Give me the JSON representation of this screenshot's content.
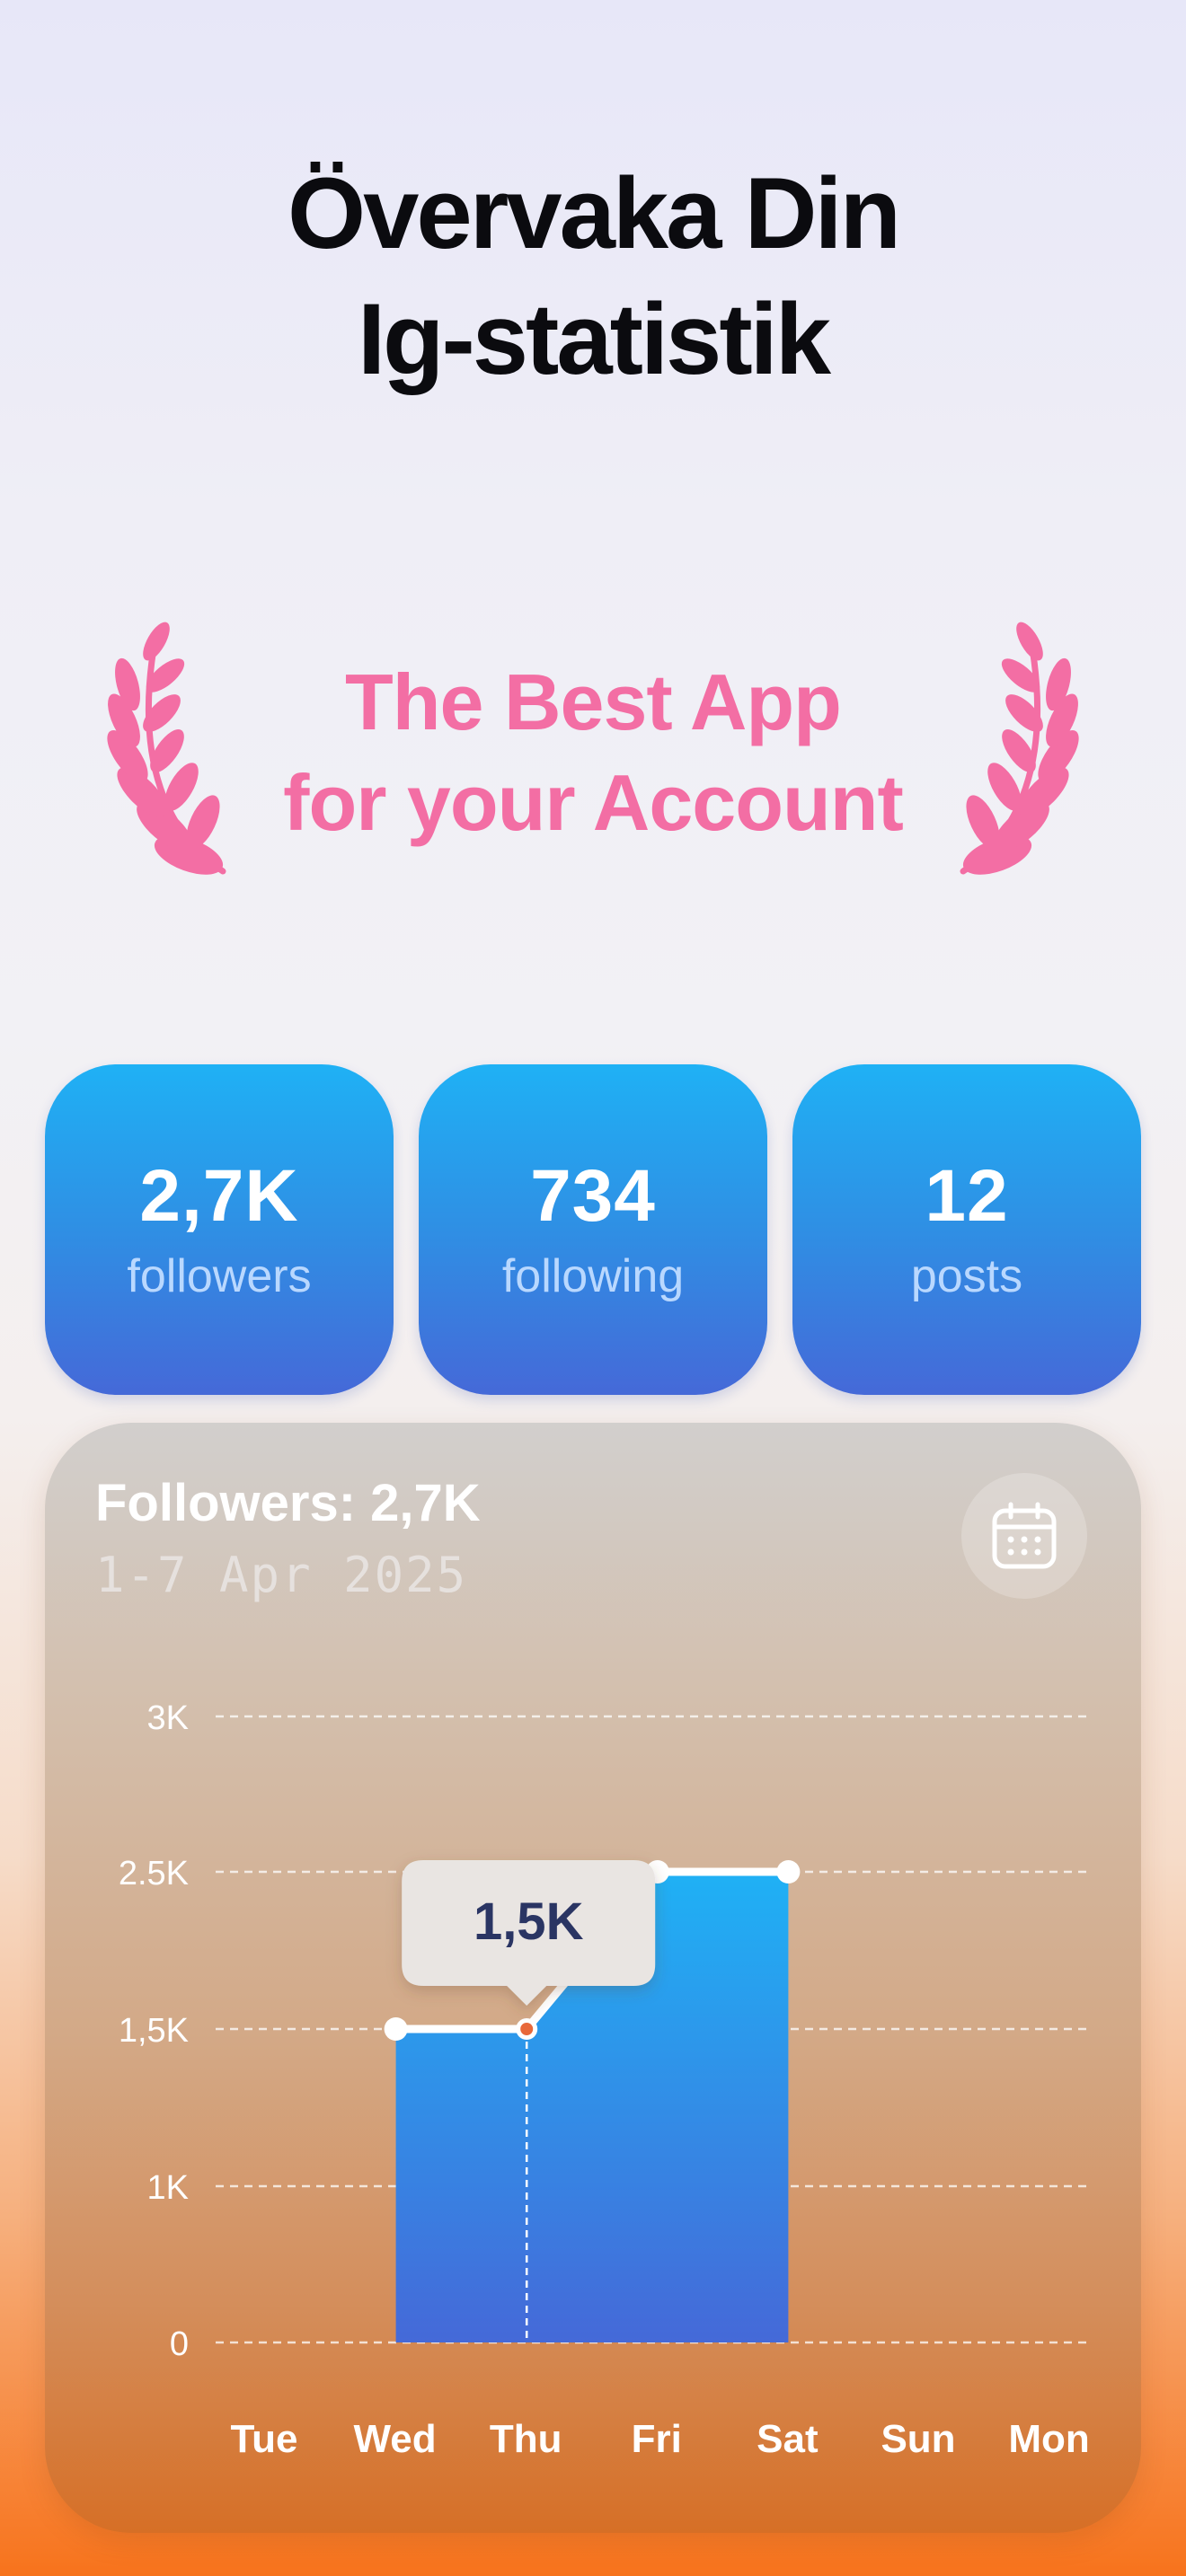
{
  "headline": {
    "line1": "Övervaka Din",
    "line2": "Ig-statistik"
  },
  "award": {
    "line1": "The Best App",
    "line2": "for your Account"
  },
  "stats": [
    {
      "value": "2,7K",
      "label": "followers"
    },
    {
      "value": "734",
      "label": "following"
    },
    {
      "value": "12",
      "label": "posts"
    }
  ],
  "card": {
    "title": "Followers: 2,7K",
    "range": "1-7 Apr 2025",
    "calendar_icon": "calendar-icon"
  },
  "colors": {
    "award_pink": "#f36ea4",
    "stat_blue_top": "#1fb1f5",
    "stat_blue_bottom": "#4569d8",
    "tooltip_text": "#2c3564",
    "marker_orange": "#e8683a"
  },
  "chart_data": {
    "type": "area",
    "categories": [
      "Tue",
      "Wed",
      "Thu",
      "Fri",
      "Sat",
      "Sun",
      "Mon"
    ],
    "y_ticks": [
      {
        "value": 0,
        "label": "0"
      },
      {
        "value": 1000,
        "label": "1K"
      },
      {
        "value": 1500,
        "label": "1,5K"
      },
      {
        "value": 2500,
        "label": "2.5K"
      },
      {
        "value": 3000,
        "label": "3K"
      }
    ],
    "points": [
      {
        "category": "Wed",
        "value": 1500
      },
      {
        "category": "Thu",
        "value": 1500
      },
      {
        "category": "Fri",
        "value": 2500
      },
      {
        "category": "Sat",
        "value": 2500
      }
    ],
    "tooltip": {
      "category": "Thu",
      "label": "1,5K"
    },
    "grid": "dashed"
  }
}
